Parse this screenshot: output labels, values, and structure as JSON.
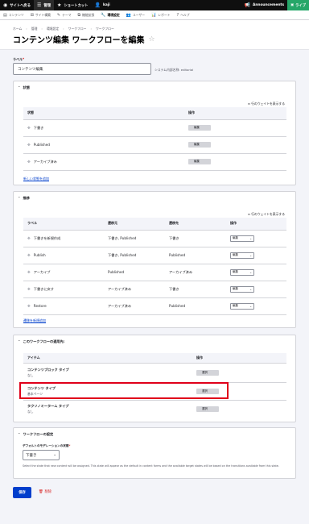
{
  "toolbar": {
    "back_site": "サイトへ戻る",
    "manage": "管理",
    "shortcuts": "ショートカット",
    "user": "kaji",
    "announcements": "Announcements",
    "live": "ライブ"
  },
  "tray": {
    "items": [
      "コンテンツ",
      "サイト構築",
      "テーマ",
      "機能拡張",
      "環境設定",
      "ユーザー",
      "レポート",
      "ヘルプ"
    ],
    "active_index": 4
  },
  "breadcrumb": [
    "ホーム",
    "管理",
    "環境設定",
    "ワークフロー",
    "ワークフロー"
  ],
  "page_title": "コンテンツ編集 ワークフローを編集",
  "label_field": {
    "label": "ラベル",
    "required_mark": "*",
    "value": "コンテンツ編集",
    "machine_name": "システム内部名称: editorial"
  },
  "states": {
    "title": "状態",
    "weights_link": "行のウェイトを表示する",
    "col_state": "状態",
    "col_ops": "操作",
    "rows": [
      {
        "label": "下書き",
        "op": "編集"
      },
      {
        "label": "Published",
        "op": "編集"
      },
      {
        "label": "アーカイブ済み",
        "op": "編集"
      }
    ],
    "add_link": "新しい状態を追加"
  },
  "transitions": {
    "title": "推移",
    "weights_link": "行のウェイトを表示する",
    "cols": [
      "ラベル",
      "遷移元",
      "遷移先",
      "操作"
    ],
    "rows": [
      {
        "label": "下書きを新規作成",
        "from": "下書き, Published",
        "to": "下書き",
        "op": "編集"
      },
      {
        "label": "Publish",
        "from": "下書き, Published",
        "to": "Published",
        "op": "編集"
      },
      {
        "label": "アーカイブ",
        "from": "Published",
        "to": "アーカイブ済み",
        "op": "編集"
      },
      {
        "label": "下書きに戻す",
        "from": "アーカイブ済み",
        "to": "下書き",
        "op": "編集"
      },
      {
        "label": "Restore",
        "from": "アーカイブ済み",
        "to": "Published",
        "op": "編集"
      }
    ],
    "add_link": "遷移を新規追加"
  },
  "applies": {
    "title": "このワークフローの適用先:",
    "col_item": "アイテム",
    "col_ops": "操作",
    "rows": [
      {
        "name": "コンテンツブロック タイプ",
        "sub": "なし",
        "op": "選択"
      },
      {
        "name": "コンテンツ タイプ",
        "sub": "基本ページ",
        "op": "選択"
      },
      {
        "name": "タクソノミーターム タイプ",
        "sub": "なし",
        "op": "選択"
      }
    ]
  },
  "settings": {
    "title": "ワークフローの設定",
    "default_label": "デフォルトのモデレーションの状態",
    "required_mark": "*",
    "default_value": "下書き",
    "description": "Select the state that new content will be assigned. This state will appear as the default in content forms and the available target states will be based on the transitions available from this state."
  },
  "actions": {
    "save": "保存",
    "delete": "削除"
  },
  "colors": {
    "primary": "#003ecc",
    "danger": "#d72222",
    "live": "#26a769",
    "highlight": "#e0001a"
  }
}
